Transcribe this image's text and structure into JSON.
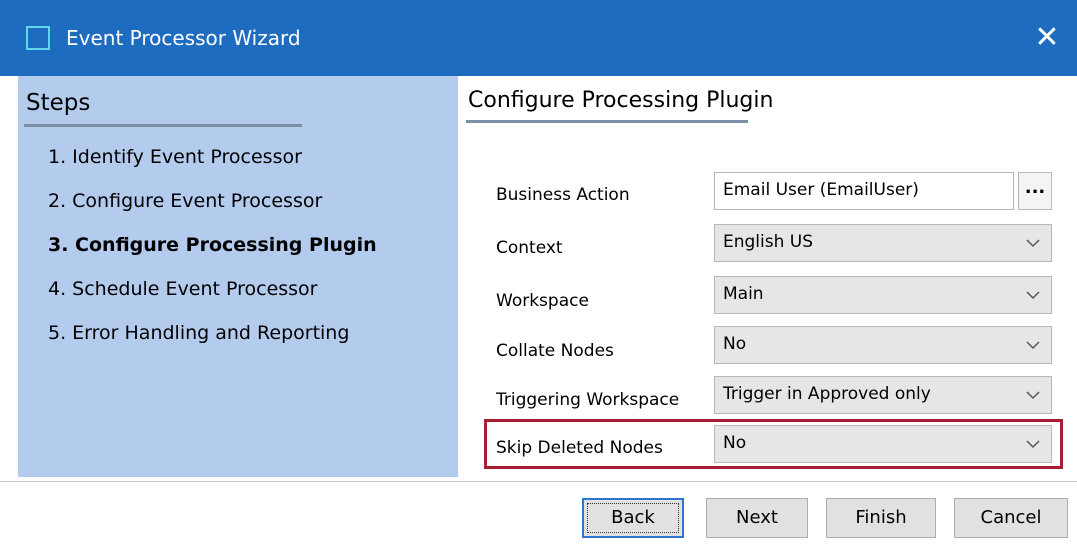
{
  "window": {
    "title": "Event Processor Wizard",
    "close_symbol": "✕",
    "accent_color": "#1e6cbf"
  },
  "steps": {
    "title": "Steps",
    "items": [
      {
        "label": "1. Identify Event Processor",
        "active": false
      },
      {
        "label": "2. Configure Event Processor",
        "active": false
      },
      {
        "label": "3. Configure Processing Plugin",
        "active": true
      },
      {
        "label": "4. Schedule Event Processor",
        "active": false
      },
      {
        "label": "5. Error Handling and Reporting",
        "active": false
      }
    ]
  },
  "page": {
    "title": "Configure Processing Plugin"
  },
  "form": {
    "business_action": {
      "label": "Business Action",
      "value": "Email User (EmailUser)",
      "browse_label": "..."
    },
    "context": {
      "label": "Context",
      "value": "English US"
    },
    "workspace": {
      "label": "Workspace",
      "value": "Main"
    },
    "collate_nodes": {
      "label": "Collate Nodes",
      "value": "No"
    },
    "triggering_workspace": {
      "label": "Triggering Workspace",
      "value": "Trigger in Approved only"
    },
    "skip_deleted_nodes": {
      "label": "Skip Deleted Nodes",
      "value": "No"
    }
  },
  "highlight_color": "#a52030",
  "buttons": {
    "back": "Back",
    "next": "Next",
    "finish": "Finish",
    "cancel": "Cancel"
  }
}
